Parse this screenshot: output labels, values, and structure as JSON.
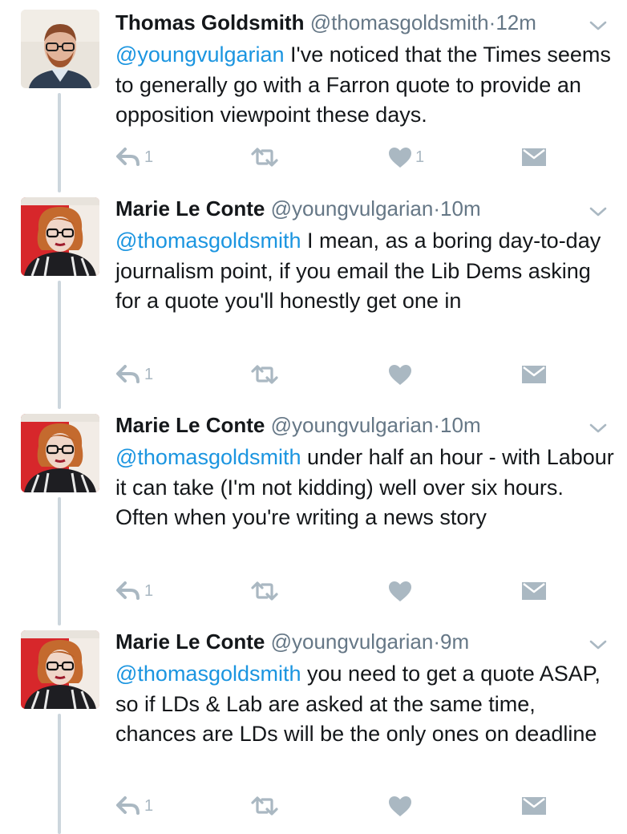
{
  "tweets": [
    {
      "name": "Thomas Goldsmith",
      "handle": "@thomasgoldsmith",
      "separator": "·",
      "time": "12m",
      "mention": "@youngvulgarian",
      "text": " I've noticed that the Times seems to generally go with a Farron quote to provide an opposition viewpoint these days.",
      "reply_count": "1",
      "retweet_count": "",
      "like_count": "1",
      "avatar": "man-with-glasses"
    },
    {
      "name": "Marie Le Conte",
      "handle": "@youngvulgarian",
      "separator": "·",
      "time": "10m",
      "mention": "@thomasgoldsmith",
      "text": " I mean, as a boring day-to-day journalism point, if you email the Lib Dems asking for a quote you'll honestly get one in",
      "reply_count": "1",
      "retweet_count": "",
      "like_count": "",
      "avatar": "woman-red-hair"
    },
    {
      "name": "Marie Le Conte",
      "handle": "@youngvulgarian",
      "separator": "·",
      "time": "10m",
      "mention": "@thomasgoldsmith",
      "text": " under half an hour - with Labour it can take (I'm not kidding) well over six hours. Often when you're writing a news story",
      "reply_count": "1",
      "retweet_count": "",
      "like_count": "",
      "avatar": "woman-red-hair"
    },
    {
      "name": "Marie Le Conte",
      "handle": "@youngvulgarian",
      "separator": "·",
      "time": "9m",
      "mention": "@thomasgoldsmith",
      "text": " you need to get a quote ASAP, so if LDs & Lab are asked at the same time, chances are LDs will be the only ones on deadline",
      "reply_count": "1",
      "retweet_count": "",
      "like_count": "",
      "avatar": "woman-red-hair"
    }
  ],
  "icons": {
    "reply": "reply-icon",
    "retweet": "retweet-icon",
    "like": "heart-icon",
    "dm": "envelope-icon",
    "more": "chevron-down-icon"
  },
  "colors": {
    "link": "#1b95e0",
    "secondary_text": "#657786",
    "icon": "#aab8c2",
    "thread_line": "#ccd6dd"
  }
}
